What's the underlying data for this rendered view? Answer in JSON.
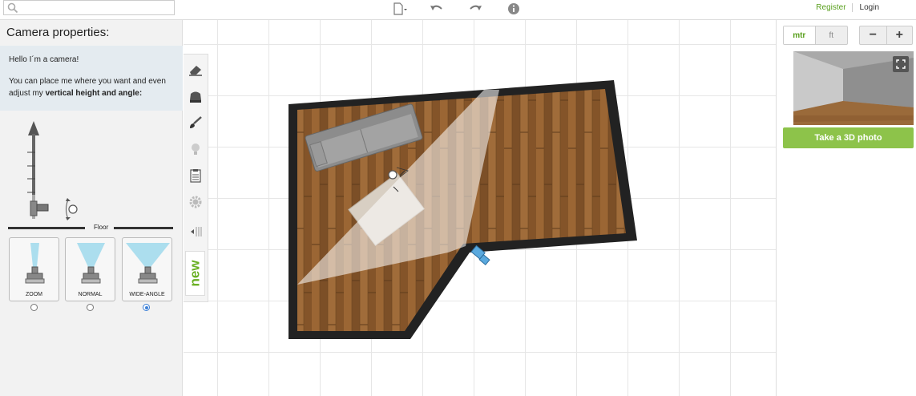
{
  "topbar": {
    "search_placeholder": "",
    "register_label": "Register",
    "login_label": "Login",
    "icons": [
      "new-file-icon",
      "undo-icon",
      "redo-icon",
      "info-icon"
    ]
  },
  "camera_panel": {
    "title": "Camera properties:",
    "intro_line1": "Hello I´m a camera!",
    "intro_line2_pre": "You can place me where you want and even adjust my ",
    "intro_line2_strong": "vertical height and angle:",
    "floor_label": "Floor",
    "lenses": [
      {
        "label": "ZOOM",
        "selected": false
      },
      {
        "label": "NORMAL",
        "selected": false
      },
      {
        "label": "WIDE-ANGLE",
        "selected": true
      }
    ]
  },
  "tools": {
    "items": [
      "eraser-icon",
      "furniture-icon",
      "paint-brush-icon",
      "light-bulb-icon",
      "clipboard-icon",
      "settings-gear-icon",
      "collapse-icon"
    ],
    "new_badge": "new"
  },
  "right_panel": {
    "units": {
      "metric": "mtr",
      "imperial": "ft",
      "active": "mtr"
    },
    "zoom_out": "−",
    "zoom_in": "+",
    "photo_button": "Take a 3D photo"
  },
  "colors": {
    "accent_green": "#8dc34a",
    "link_green": "#5aa01e",
    "wall": "#222222",
    "floor_wood": "#8a5a2e",
    "info_box": "#e4ebf0"
  }
}
